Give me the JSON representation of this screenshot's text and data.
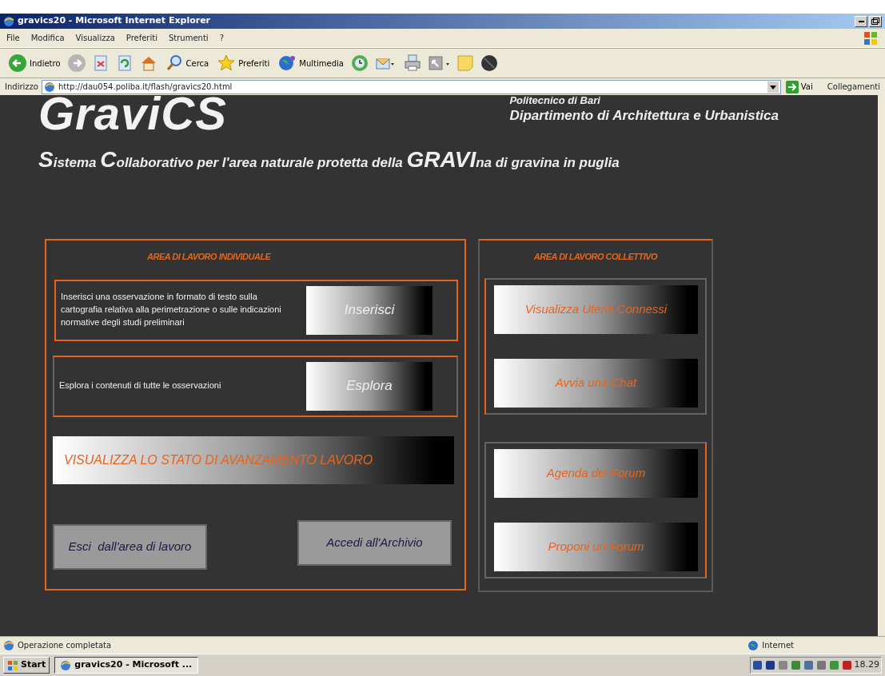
{
  "window": {
    "title": "gravics20 - Microsoft Internet Explorer"
  },
  "menu": [
    "File",
    "Modifica",
    "Visualizza",
    "Preferiti",
    "Strumenti",
    "?"
  ],
  "toolbar": [
    {
      "kind": "back",
      "label": "Indietro"
    },
    {
      "kind": "forward"
    },
    {
      "kind": "stop"
    },
    {
      "kind": "refresh"
    },
    {
      "kind": "home"
    },
    {
      "kind": "search",
      "label": "Cerca"
    },
    {
      "kind": "favorites",
      "label": "Preferiti"
    },
    {
      "kind": "media",
      "label": "Multimedia"
    },
    {
      "kind": "history"
    },
    {
      "kind": "mail"
    },
    {
      "kind": "print"
    },
    {
      "kind": "edit"
    },
    {
      "kind": "note"
    },
    {
      "kind": "messenger"
    }
  ],
  "address": {
    "label": "Indirizzo",
    "value": "http://dau054.poliba.it/flash/gravics20.html",
    "go": "Vai",
    "links": "Collegamenti"
  },
  "page": {
    "logo": "GraviCS",
    "institution": "Politecnico di Bari",
    "department": "Dipartimento di Architettura e Urbanistica",
    "subtitle": [
      {
        "text": "S",
        "big": true
      },
      {
        "text": "istema ",
        "big": false
      },
      {
        "text": "C",
        "big": true
      },
      {
        "text": "ollaborativo per l'area naturale protetta della ",
        "big": false
      },
      {
        "text": "GRAVI",
        "big": true
      },
      {
        "text": "na di gravina in puglia",
        "big": false
      }
    ],
    "individual": {
      "title": "AREA DI LAVORO INDIVIDUALE",
      "actions": [
        {
          "description": "Inserisci una osservazione in formato di testo sulla cartografia relativa alla perimetrazione o sulle indicazioni normative degli studi preliminari",
          "button": "Inserisci"
        },
        {
          "description": "Esplora i contenuti di tutte le osservazioni",
          "button": "Esplora"
        }
      ],
      "progress_button": "VISUALIZZA LO STATO DI AVANZAMENTO LAVORO",
      "bottom_buttons": [
        "Esci  dall'area di lavoro",
        "Accedi all'Archivio"
      ]
    },
    "collective": {
      "title": "AREA DI LAVORO COLLETTIVO",
      "groups": [
        [
          "Visualizza Utenti Connessi",
          "Avvia una Chat"
        ],
        [
          "Agenda dei Forum",
          "Proponi un Forum"
        ]
      ]
    }
  },
  "status_bar": {
    "text": "Operazione completata",
    "zone": "Internet"
  },
  "taskbar": {
    "start": "Start",
    "tasks": [
      "gravics20 - Microsoft ..."
    ],
    "clock": "18.29"
  }
}
